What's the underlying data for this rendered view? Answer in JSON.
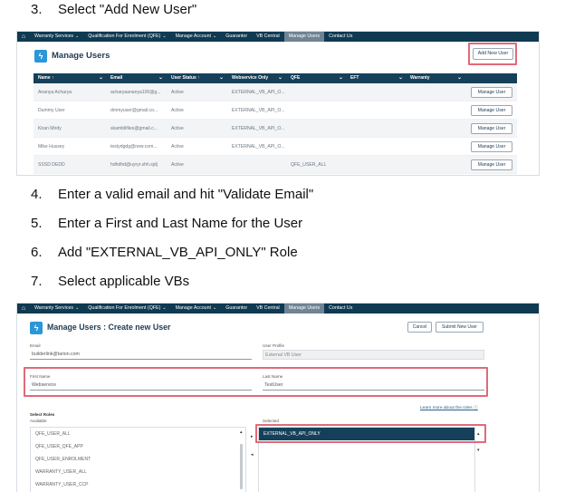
{
  "steps": {
    "s3": {
      "num": "3.",
      "text": "Select \"Add New User\""
    },
    "s4": {
      "num": "4.",
      "text": "Enter a valid email and hit \"Validate Email\""
    },
    "s5": {
      "num": "5.",
      "text": "Enter a First and Last Name for the User"
    },
    "s6": {
      "num": "6.",
      "text": "Add \"EXTERNAL_VB_API_ONLY\" Role"
    },
    "s7": {
      "num": "7.",
      "text": "Select applicable VBs"
    }
  },
  "nav": {
    "home_icon": "⌂",
    "items": [
      "Warranty Services",
      "Qualification For Enrolment (QFE)",
      "Manage Account",
      "Guarantor",
      "VB Central",
      "Manage Users",
      "Contact Us"
    ],
    "chevron": "⌄"
  },
  "colors": {
    "nav_bg": "#0f3a52",
    "active_tab": "#6f8494",
    "accent": "#2b96d8",
    "highlight": "#e06a7a",
    "selected_role": "#16405a"
  },
  "manage_users": {
    "title": "Manage Users",
    "icon": "lightning-icon",
    "add_button": "Add New User",
    "columns": [
      "Name ↑",
      "Email",
      "User Status ↑",
      "Webservice Only",
      "QFE",
      "EFT",
      "Warranty"
    ],
    "rows": [
      {
        "name": "Ananya Acharya",
        "email": "acharyaananya100@g...",
        "status": "Active",
        "webservice": "EXTERNAL_VB_API_O...",
        "qfe": "",
        "eft": "",
        "warranty": "",
        "action": "Manage User"
      },
      {
        "name": "Dummy User",
        "email": "dmmyuser@gmail.co...",
        "status": "Active",
        "webservice": "EXTERNAL_VB_API_O...",
        "qfe": "",
        "eft": "",
        "warranty": "",
        "action": "Manage User"
      },
      {
        "name": "Kiran Mirdy",
        "email": "skamblifiles@gmail.c...",
        "status": "Active",
        "webservice": "EXTERNAL_VB_API_O...",
        "qfe": "",
        "eft": "",
        "warranty": "",
        "action": "Manage User"
      },
      {
        "name": "Mike Hussey",
        "email": "testydgdg@new.com...",
        "status": "Active",
        "webservice": "EXTERNAL_VB_API_O...",
        "qfe": "",
        "eft": "",
        "warranty": "",
        "action": "Manage User"
      },
      {
        "name": "SSSD DEDD",
        "email": "hdhdhd@uyryr.shh.sjdj",
        "status": "Active",
        "webservice": "",
        "qfe": "QFE_USER_ALL",
        "eft": "",
        "warranty": "",
        "action": "Manage User"
      }
    ]
  },
  "create_user": {
    "title": "Manage Users : Create new User",
    "cancel": "Cancel",
    "submit": "Submit New User",
    "email_label": "Email",
    "email_value": "builderlink@tarion.com",
    "profile_label": "User Profile",
    "profile_value": "External VB User",
    "first_label": "First Name",
    "first_value": "Webservice",
    "last_label": "Last Name",
    "last_value": "TestUser",
    "learn_more": "Learn more about the roles",
    "info_icon": "ⓘ",
    "select_roles": "Select Roles",
    "available": "Available",
    "selected": "Selected",
    "available_roles": [
      "QFE_USER_ALL",
      "QFE_USER_QFE_APP",
      "QFE_USER_ENROLMENT",
      "WARRANTY_USER_ALL",
      "WARRANTY_USER_CCP"
    ],
    "selected_roles": [
      "EXTERNAL_VB_API_ONLY"
    ],
    "move_right": "▸",
    "move_left": "◂",
    "move_up": "▴",
    "move_down": "▾"
  }
}
